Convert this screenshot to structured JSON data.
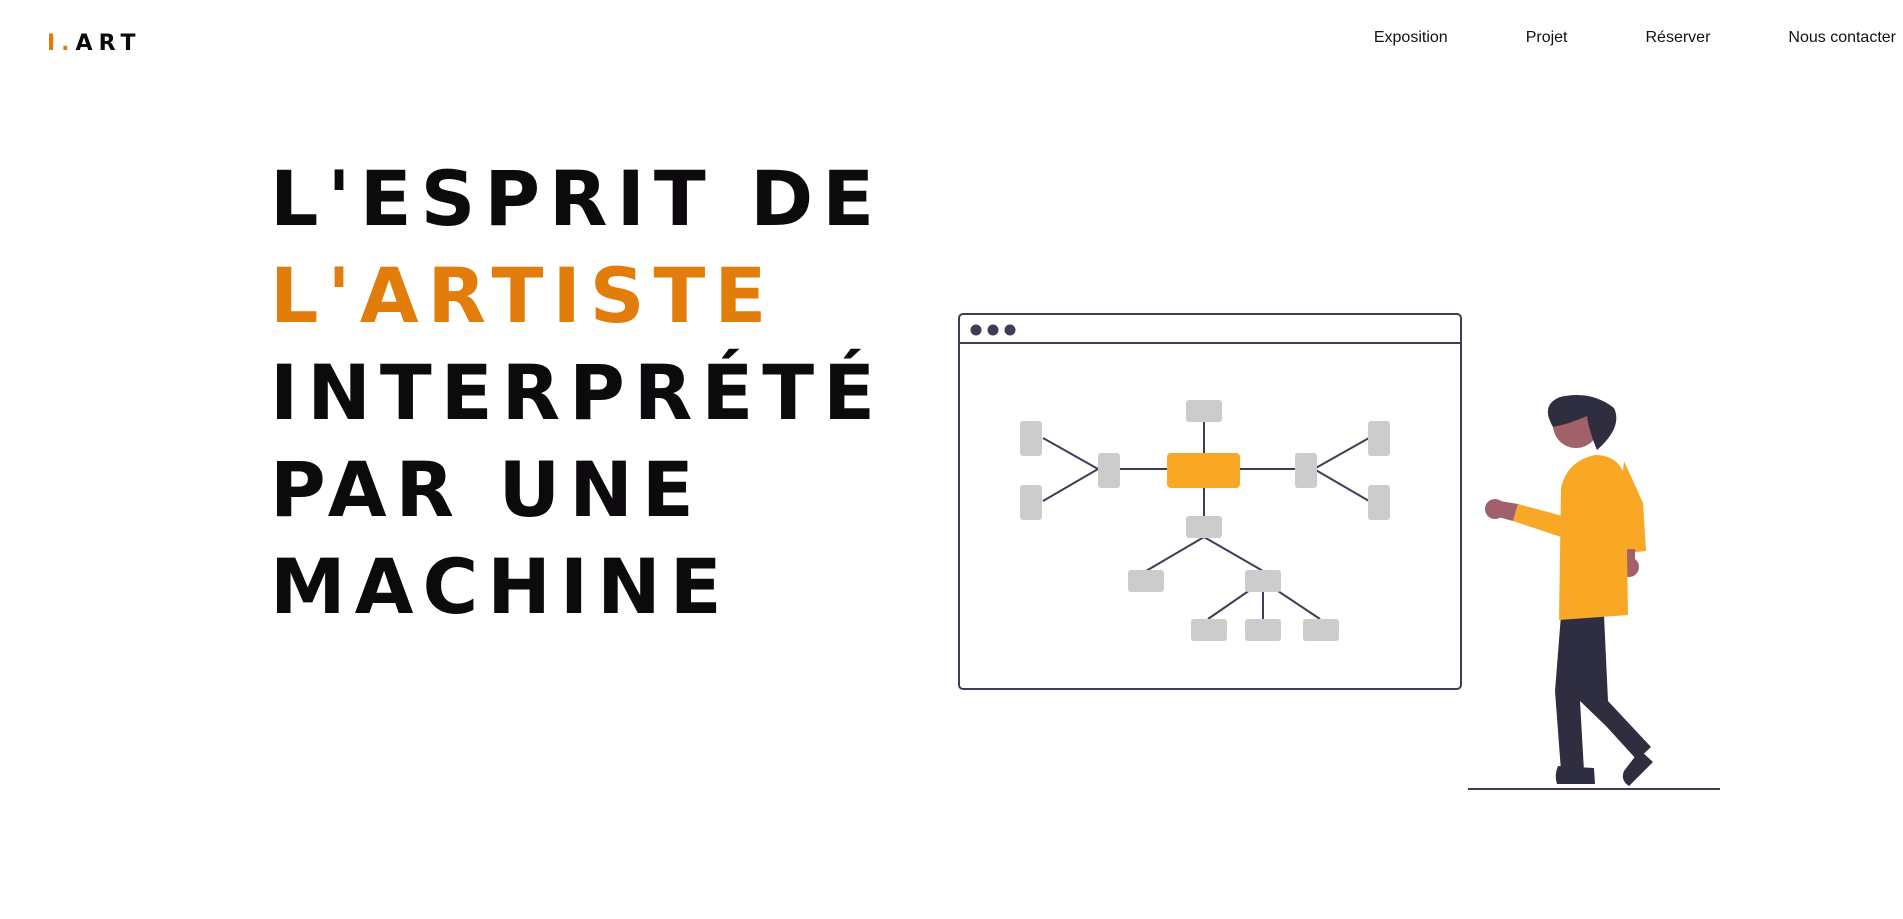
{
  "brand": {
    "logo_mark": "I.",
    "logo_text": "ART",
    "accent_color": "#e27c0a",
    "illustration_accent": "#f9a826"
  },
  "nav": {
    "items": [
      {
        "label": "Exposition"
      },
      {
        "label": "Projet"
      },
      {
        "label": "Réserver"
      },
      {
        "label": "Nous contacter"
      }
    ]
  },
  "hero": {
    "lines": [
      "L'ESPRIT DE",
      "L'ARTISTE",
      "INTERPRÉTÉ",
      "PAR UNE",
      "MACHINE"
    ],
    "accent_line_index": 1
  },
  "illustration": {
    "subject": "person presenting a mind-map diagram on a browser window",
    "icon": "mind-map-presentation-illustration"
  }
}
